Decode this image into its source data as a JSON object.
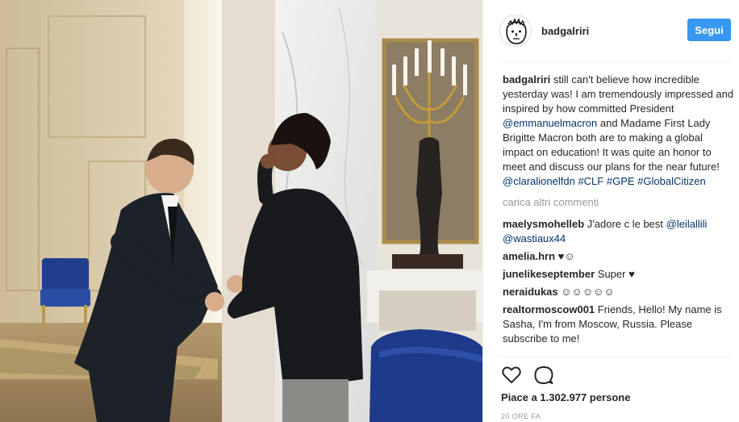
{
  "post": {
    "author": "badgalriri",
    "follow_label": "Segui",
    "caption": {
      "username": "badgalriri",
      "text_part1": " still can't believe how incredible yesterday was! I am tremendously impressed and inspired by how committed President ",
      "mention1": "@emmanuelmacron",
      "text_part2": " and Madame First Lady Brigitte Macron both are to making a global impact on education! It was quite an honor to meet and discuss our plans for the near future! ",
      "mention2": "@claralionelfdn",
      "hashtag1": "#CLF",
      "hashtag2": "#GPE",
      "hashtag3": "#GlobalCitizen"
    },
    "load_more_label": "carica altri commenti",
    "comments": [
      {
        "username": "maelysmohelleb",
        "text": " J'adore c le best ",
        "mention1": "@leilallili",
        "mention2": "@wastiaux44"
      },
      {
        "username": "amelia.hrn",
        "text": " ♥☺"
      },
      {
        "username": "junelikeseptember",
        "text": " Super ♥"
      },
      {
        "username": "neraidukas",
        "text": " ☺☺☺☺☺"
      },
      {
        "username": "realtormoscow001",
        "text": " Friends, Hello! My name is Sasha, I'm from Moscow, Russia. Please subscribe to me!"
      }
    ],
    "likes_label": "Piace a 1.302.977 persone",
    "timestamp": "20 ORE FA"
  },
  "icons": {
    "like": "heart-icon",
    "comment": "comment-icon",
    "avatar": "sketch-face-avatar"
  },
  "colors": {
    "accent": "#3897f0",
    "link": "#003569",
    "muted": "#999999",
    "text": "#262626"
  }
}
